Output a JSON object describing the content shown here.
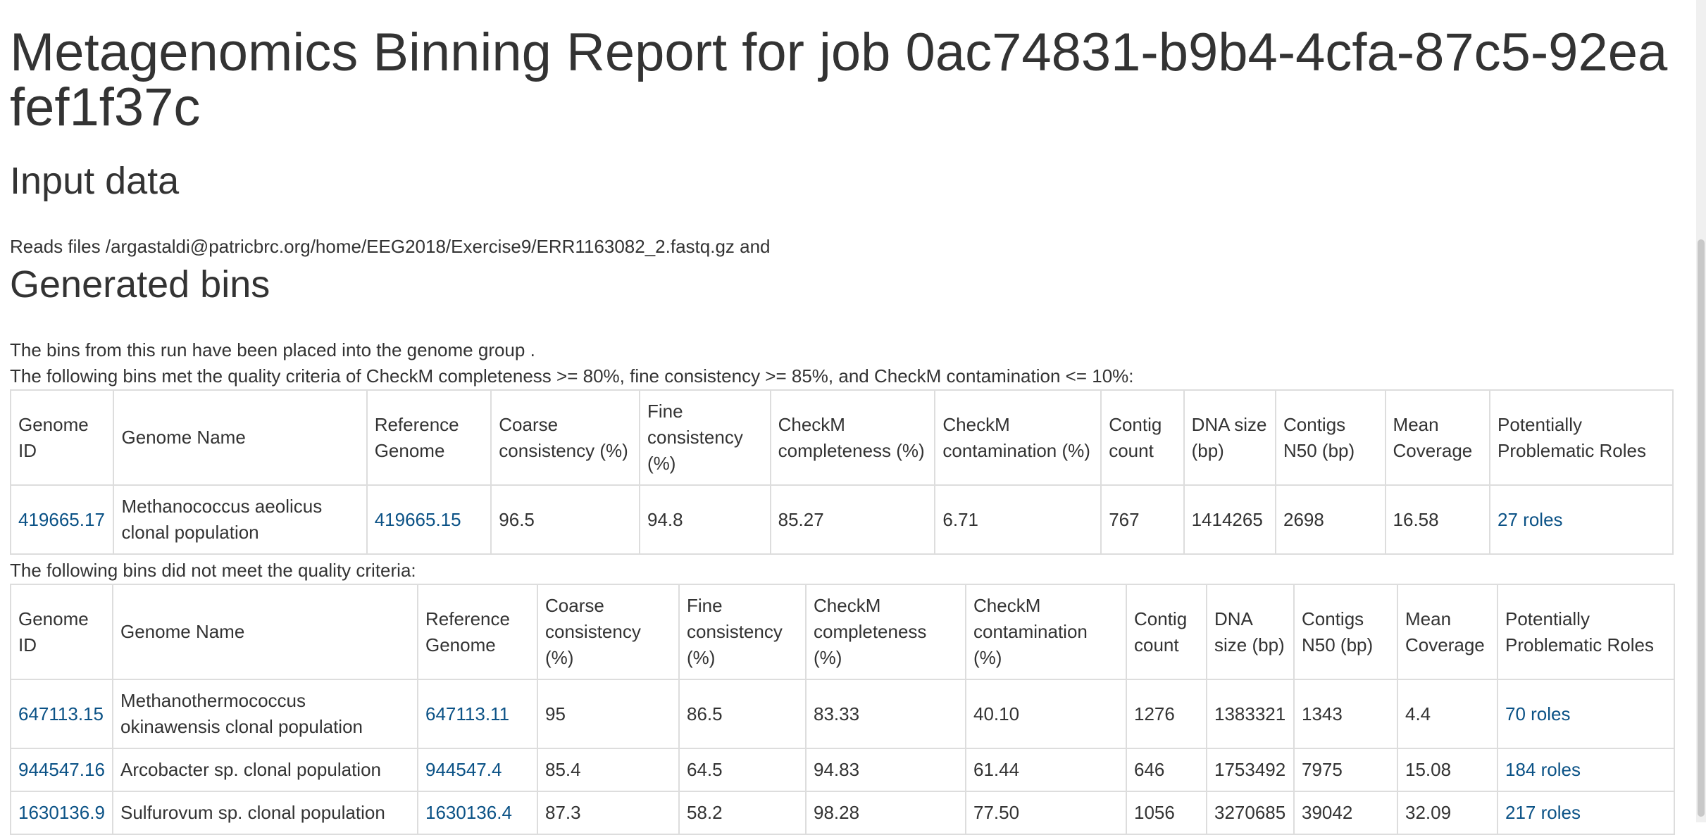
{
  "title": "Metagenomics Binning Report for job 0ac74831-b9b4-4cfa-87c5-92eafef1f37c",
  "input_heading": "Input data",
  "reads_text": "Reads files /argastaldi@patricbrc.org/home/EEG2018/Exercise9/ERR1163082_2.fastq.gz and",
  "bins_heading": "Generated bins",
  "group_text": "The bins from this run have been placed into the genome group .",
  "good_caption": "The following bins met the quality criteria of CheckM completeness >= 80%, fine consistency >= 85%, and CheckM contamination <= 10%:",
  "bad_caption": "The following bins did not meet the quality criteria:",
  "headers": {
    "genome_id": "Genome ID",
    "genome_name": "Genome Name",
    "reference": "Reference Genome",
    "coarse": "Coarse consistency (%)",
    "fine": "Fine consistency (%)",
    "completeness": "CheckM completeness (%)",
    "contamination": "CheckM contamination (%)",
    "contig_count": "Contig count",
    "dna_size": "DNA size (bp)",
    "n50": "Contigs N50 (bp)",
    "coverage": "Mean Coverage",
    "roles": "Potentially Problematic Roles"
  },
  "good_bins": [
    {
      "genome_id": "419665.17",
      "genome_name": "Methanococcus aeolicus clonal population",
      "reference": "419665.15",
      "coarse": "96.5",
      "fine": "94.8",
      "completeness": "85.27",
      "contamination": "6.71",
      "contig_count": "767",
      "dna_size": "1414265",
      "n50": "2698",
      "coverage": "16.58",
      "roles": "27 roles"
    }
  ],
  "bad_bins": [
    {
      "genome_id": "647113.15",
      "genome_name": "Methanothermococcus okinawensis clonal population",
      "reference": "647113.11",
      "coarse": "95",
      "fine": "86.5",
      "completeness": "83.33",
      "contamination": "40.10",
      "contig_count": "1276",
      "dna_size": "1383321",
      "n50": "1343",
      "coverage": "4.4",
      "roles": "70 roles"
    },
    {
      "genome_id": "944547.16",
      "genome_name": "Arcobacter sp. clonal population",
      "reference": "944547.4",
      "coarse": "85.4",
      "fine": "64.5",
      "completeness": "94.83",
      "contamination": "61.44",
      "contig_count": "646",
      "dna_size": "1753492",
      "n50": "7975",
      "coverage": "15.08",
      "roles": "184 roles"
    },
    {
      "genome_id": "1630136.9",
      "genome_name": "Sulfurovum sp. clonal population",
      "reference": "1630136.4",
      "coarse": "87.3",
      "fine": "58.2",
      "completeness": "98.28",
      "contamination": "77.50",
      "contig_count": "1056",
      "dna_size": "3270685",
      "n50": "39042",
      "coverage": "32.09",
      "roles": "217 roles"
    }
  ]
}
